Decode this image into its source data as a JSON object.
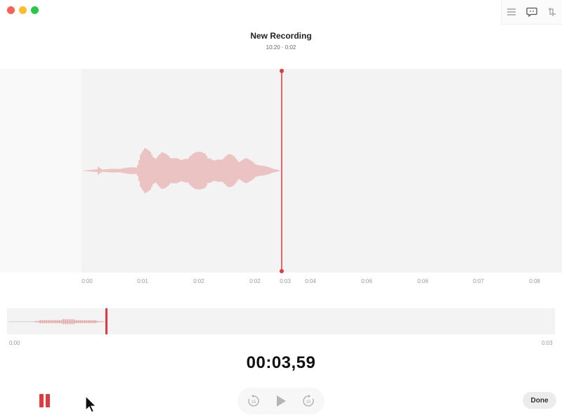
{
  "window": {
    "title": "New Recording",
    "subtitle": "10:20 · 0:02"
  },
  "toolbar": {
    "icons": [
      "list-icon",
      "transcript-icon",
      "trim-icon"
    ]
  },
  "timeline": {
    "ticks": [
      "0:00",
      "0:01",
      "0:02",
      "0:02",
      "0:03",
      "0:04",
      "0:06",
      "0:06",
      "0:07",
      "0:08"
    ],
    "overview_start": "0:00",
    "overview_end": "0:03"
  },
  "timer": "00:03,59",
  "controls": {
    "pause": "pause-icon",
    "skip_back_label": "15",
    "play": "play-icon",
    "skip_forward_label": "15",
    "done_label": "Done"
  },
  "colors": {
    "accent": "#e0393e",
    "waveform": "#e8a3a3",
    "background": "#f3f3f3"
  }
}
